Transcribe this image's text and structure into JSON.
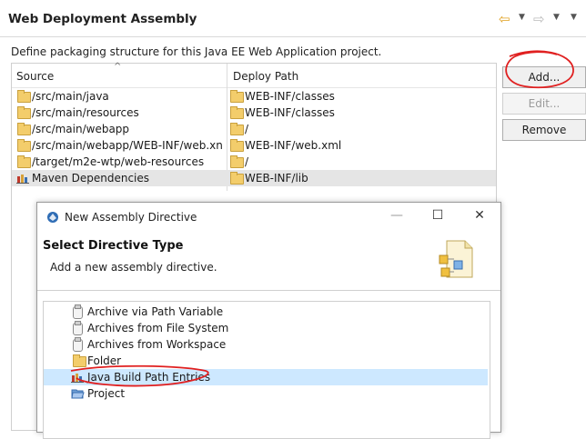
{
  "header": {
    "title": "Web Deployment Assembly",
    "back_icon": "back-arrow-icon",
    "forward_icon": "forward-arrow-icon"
  },
  "description": "Define packaging structure for this Java EE Web Application project.",
  "table": {
    "columns": [
      "Source",
      "Deploy Path"
    ],
    "rows": [
      {
        "source": "/src/main/java",
        "deploy": "WEB-INF/classes",
        "icon": "folder-icon",
        "selected": false
      },
      {
        "source": "/src/main/resources",
        "deploy": "WEB-INF/classes",
        "icon": "folder-icon",
        "selected": false
      },
      {
        "source": "/src/main/webapp",
        "deploy": "/",
        "icon": "folder-icon",
        "selected": false
      },
      {
        "source": "/src/main/webapp/WEB-INF/web.xn",
        "deploy": "WEB-INF/web.xml",
        "icon": "folder-icon",
        "selected": false
      },
      {
        "source": "/target/m2e-wtp/web-resources",
        "deploy": "/",
        "icon": "folder-icon",
        "selected": false
      },
      {
        "source": "Maven Dependencies",
        "deploy": "WEB-INF/lib",
        "icon": "library-icon",
        "selected": true
      }
    ]
  },
  "buttons": {
    "add": "Add...",
    "edit": "Edit...",
    "remove": "Remove"
  },
  "dialog": {
    "title": "New Assembly Directive",
    "heading": "Select Directive Type",
    "subtitle": "Add a new assembly directive.",
    "items": [
      {
        "label": "Archive via Path Variable",
        "icon": "archive-icon",
        "selected": false
      },
      {
        "label": "Archives from File System",
        "icon": "archive-icon",
        "selected": false
      },
      {
        "label": "Archives from Workspace",
        "icon": "archive-icon",
        "selected": false
      },
      {
        "label": "Folder",
        "icon": "folder-icon",
        "selected": false
      },
      {
        "label": "Java Build Path Entries",
        "icon": "library-icon",
        "selected": true
      },
      {
        "label": "Project",
        "icon": "project-folder-icon",
        "selected": false
      }
    ]
  },
  "colors": {
    "selection_gray": "#e5e5e5",
    "selection_blue": "#cde8ff",
    "annotation_red": "#e02020"
  }
}
